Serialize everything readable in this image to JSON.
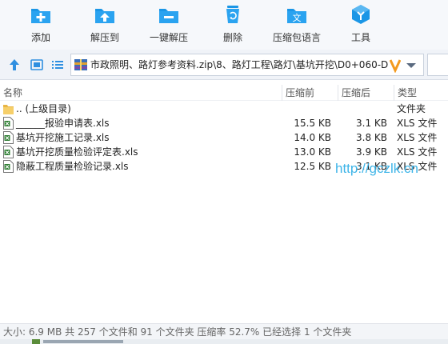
{
  "toolbar": {
    "items": [
      {
        "label": "添加",
        "icon": "add-icon"
      },
      {
        "label": "解压到",
        "icon": "extract-to-icon"
      },
      {
        "label": "一键解压",
        "icon": "one-click-extract-icon"
      },
      {
        "label": "删除",
        "icon": "delete-icon"
      },
      {
        "label": "压缩包语言",
        "icon": "archive-language-icon"
      },
      {
        "label": "工具",
        "icon": "tools-icon"
      }
    ],
    "icon_colors": {
      "blue": "#1a96e6",
      "light": "#5ab8f2"
    }
  },
  "address": {
    "path": "市政照明、路灯参考资料.zip\\8、路灯工程\\路灯\\基坑开挖\\D0+060-D",
    "icons": [
      "up-arrow-icon",
      "view-icon",
      "list-view-icon",
      "zip-archive-icon",
      "chevron-down-icon"
    ]
  },
  "columns": {
    "name": "名称",
    "size": "压缩前",
    "compressed": "压缩后",
    "type": "类型"
  },
  "files": [
    {
      "name": ".. (上级目录)",
      "size": "",
      "compressed": "",
      "type": "文件夹",
      "icon": "folder-icon"
    },
    {
      "name": "______报验申请表.xls",
      "size": "15.5 KB",
      "compressed": "3.1 KB",
      "type": "XLS 文件",
      "icon": "xls-file-icon"
    },
    {
      "name": "基坑开挖施工记录.xls",
      "size": "14.0 KB",
      "compressed": "3.8 KB",
      "type": "XLS 文件",
      "icon": "xls-file-icon"
    },
    {
      "name": "基坑开挖质量检验评定表.xls",
      "size": "13.0 KB",
      "compressed": "3.9 KB",
      "type": "XLS 文件",
      "icon": "xls-file-icon"
    },
    {
      "name": "隐蔽工程质量检验记录.xls",
      "size": "12.5 KB",
      "compressed": "3.1 KB",
      "type": "XLS 文件",
      "icon": "xls-file-icon"
    }
  ],
  "watermark": "http://gczlk.cn",
  "status": {
    "text": "大小: 6.9 MB 共 257 个文件和 91 个文件夹 压缩率 52.7% 已经选择 1 个文件夹"
  },
  "colors": {
    "accent": "#1a96e6",
    "watermark": "#3fb5e8",
    "folder": "#f0c35a",
    "xls_green": "#2e7d32"
  }
}
